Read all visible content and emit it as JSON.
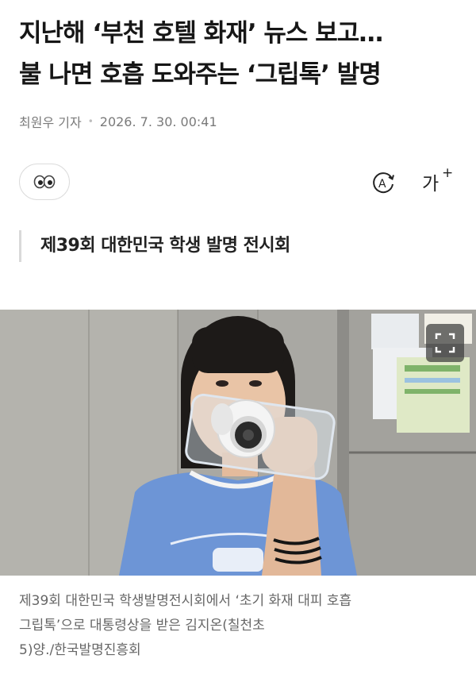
{
  "article": {
    "headline_line1": "지난해 ‘부천 호텔 화재’ 뉴스 보고…",
    "headline_line2": "불 나면 호흡 도와주는 ‘그립톡’ 발명",
    "author": "최원우 기자",
    "datetime": "2026. 7. 30. 00:41",
    "subtitle": "제39회 대한민국 학생 발명 전시회",
    "caption_line1": "제39회 대한민국 학생발명전시회에서 ‘초기 화재 대피 호흡",
    "caption_line2": "그립톡’으로 대통령상을 받은 김지온(칠천초",
    "caption_line3": "5)양./한국발명진흥회"
  },
  "toolbar": {
    "reaction_icon": "eyes-icon",
    "tts_icon": "audio-read-icon",
    "tts_letter": "A",
    "font_size_label": "가",
    "font_size_plus": "+"
  },
  "photo": {
    "expand_icon": "fullscreen-icon",
    "subject": "student holding a clear phone case with a breathing grip-tok to her mouth"
  },
  "colors": {
    "headline": "#161616",
    "meta_gray": "#7a7a7a",
    "caption_gray": "#666666",
    "shirt_blue": "#6d95d6"
  }
}
